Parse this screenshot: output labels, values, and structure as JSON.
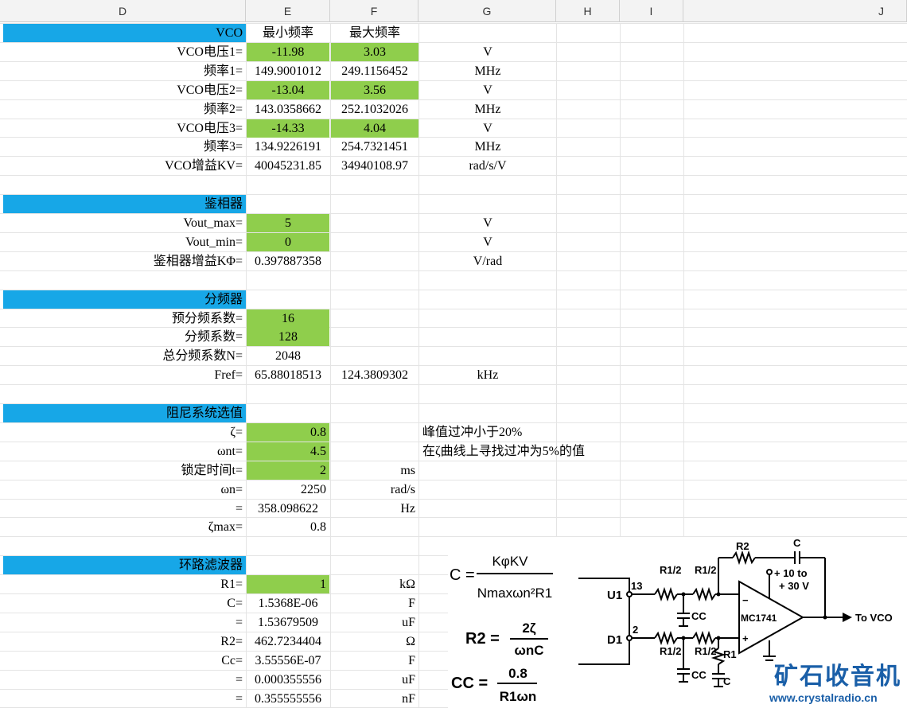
{
  "columns": [
    "D",
    "E",
    "F",
    "G",
    "H",
    "I",
    "J"
  ],
  "rows": [
    {
      "label": "VCO",
      "e": "最小频率",
      "f": "最大频率",
      "g": "",
      "hdr": true
    },
    {
      "label": "VCO电压1=",
      "e": "-11.98",
      "f": "3.03",
      "g": "V",
      "egreen": true,
      "fgreen": true
    },
    {
      "label": "频率1=",
      "e": "149.9001012",
      "f": "249.1156452",
      "g": "MHz"
    },
    {
      "label": "VCO电压2=",
      "e": "-13.04",
      "f": "3.56",
      "g": "V",
      "egreen": true,
      "fgreen": true
    },
    {
      "label": "频率2=",
      "e": "143.0358662",
      "f": "252.1032026",
      "g": "MHz"
    },
    {
      "label": "VCO电压3=",
      "e": "-14.33",
      "f": "4.04",
      "g": "V",
      "egreen": true,
      "fgreen": true
    },
    {
      "label": "频率3=",
      "e": "134.9226191",
      "f": "254.7321451",
      "g": "MHz"
    },
    {
      "label": "VCO增益KV=",
      "e": "40045231.85",
      "f": "34940108.97",
      "g": "rad/s/V"
    },
    {
      "label": "",
      "e": "",
      "f": "",
      "g": ""
    },
    {
      "label": "鉴相器",
      "e": "",
      "f": "",
      "g": "",
      "hdr": true
    },
    {
      "label": "Vout_max=",
      "e": "5",
      "f": "",
      "g": "V",
      "egreen": true
    },
    {
      "label": "Vout_min=",
      "e": "0",
      "f": "",
      "g": "V",
      "egreen": true
    },
    {
      "label": "鉴相器增益KΦ=",
      "e": "0.397887358",
      "f": "",
      "g": "V/rad"
    },
    {
      "label": "",
      "e": "",
      "f": "",
      "g": ""
    },
    {
      "label": "分频器",
      "e": "",
      "f": "",
      "g": "",
      "hdr": true
    },
    {
      "label": "预分频系数=",
      "e": "16",
      "f": "",
      "g": "",
      "egreen": true
    },
    {
      "label": "分频系数=",
      "e": "128",
      "f": "",
      "g": "",
      "egreen": true
    },
    {
      "label": "总分频系数N=",
      "e": "2048",
      "f": "",
      "g": ""
    },
    {
      "label": "Fref=",
      "e": "65.88018513",
      "f": "124.3809302",
      "g": "kHz"
    },
    {
      "label": "",
      "e": "",
      "f": "",
      "g": ""
    },
    {
      "label": "阻尼系统选值",
      "e": "",
      "f": "",
      "g": "",
      "hdr": true
    },
    {
      "label": "ζ=",
      "e": "0.8",
      "f": "",
      "g": "峰值过冲小于20%",
      "egreen": true,
      "eright": true,
      "gleft": true
    },
    {
      "label": "ωnt=",
      "e": "4.5",
      "f": "",
      "g": "在ζ曲线上寻找过冲为5%的值",
      "egreen": true,
      "eright": true,
      "gleft": true
    },
    {
      "label": "锁定时间t=",
      "e": "2",
      "f": "ms",
      "g": "",
      "egreen": true,
      "eright": true,
      "fright": true
    },
    {
      "label": "ωn=",
      "e": "2250",
      "f": "rad/s",
      "g": "",
      "eright": true,
      "fright": true
    },
    {
      "label": "=",
      "e": "358.098622",
      "f": "Hz",
      "g": "",
      "fright": true
    },
    {
      "label": "ζmax=",
      "e": "0.8",
      "f": "",
      "g": "",
      "eright": true
    },
    {
      "label": "",
      "e": "",
      "f": "",
      "g": ""
    },
    {
      "label": "环路滤波器",
      "e": "",
      "f": "",
      "g": "",
      "hdr": true
    },
    {
      "label": "R1=",
      "e": "1",
      "f": "kΩ",
      "g": "",
      "egreen": true,
      "eright": true,
      "fright": true
    },
    {
      "label": "C=",
      "e": "1.5368E-06",
      "f": "F",
      "g": "",
      "fright": true
    },
    {
      "label": "=",
      "e": "1.53679509",
      "f": "uF",
      "g": "",
      "fright": true
    },
    {
      "label": "R2=",
      "e": "462.7234404",
      "f": "Ω",
      "g": "",
      "fright": true
    },
    {
      "label": "Cc=",
      "e": "3.55556E-07",
      "f": "F",
      "g": "",
      "fright": true
    },
    {
      "label": "=",
      "e": "0.000355556",
      "f": "uF",
      "g": "",
      "fright": true
    },
    {
      "label": "=",
      "e": "0.355555556",
      "f": "nF",
      "g": "",
      "fright": true
    }
  ],
  "formulas": {
    "c_lhs": "C =",
    "c_num": "KφKV",
    "c_den": "Nmaxωn²R1",
    "r2_lhs": "R2 =",
    "r2_num": "2ζ",
    "r2_den": "ωnC",
    "cc_lhs": "CC =",
    "cc_num": "0.8",
    "cc_den": "R1ωn"
  },
  "circuit": {
    "r2": "R2",
    "c": "C",
    "r1_2a": "R1/2",
    "r1_2b": "R1/2",
    "r1_2c": "R1/2",
    "r1_2d": "R1/2",
    "r1": "R1",
    "cc1": "CC",
    "cc2": "CC",
    "c2": "C",
    "u1": "U1",
    "d1": "D1",
    "pin13": "13",
    "pin2": "2",
    "vplus": "+ 10 to",
    "vplus2": "+ 30 V",
    "opamp": "MC1741",
    "out": "To VCO",
    "minus": "−",
    "plus": "+"
  },
  "watermark": {
    "title": "矿石收音机",
    "url": "www.crystalradio.cn"
  },
  "colors": {
    "header_blue": "#17a7e7",
    "input_green": "#8fce4c"
  }
}
